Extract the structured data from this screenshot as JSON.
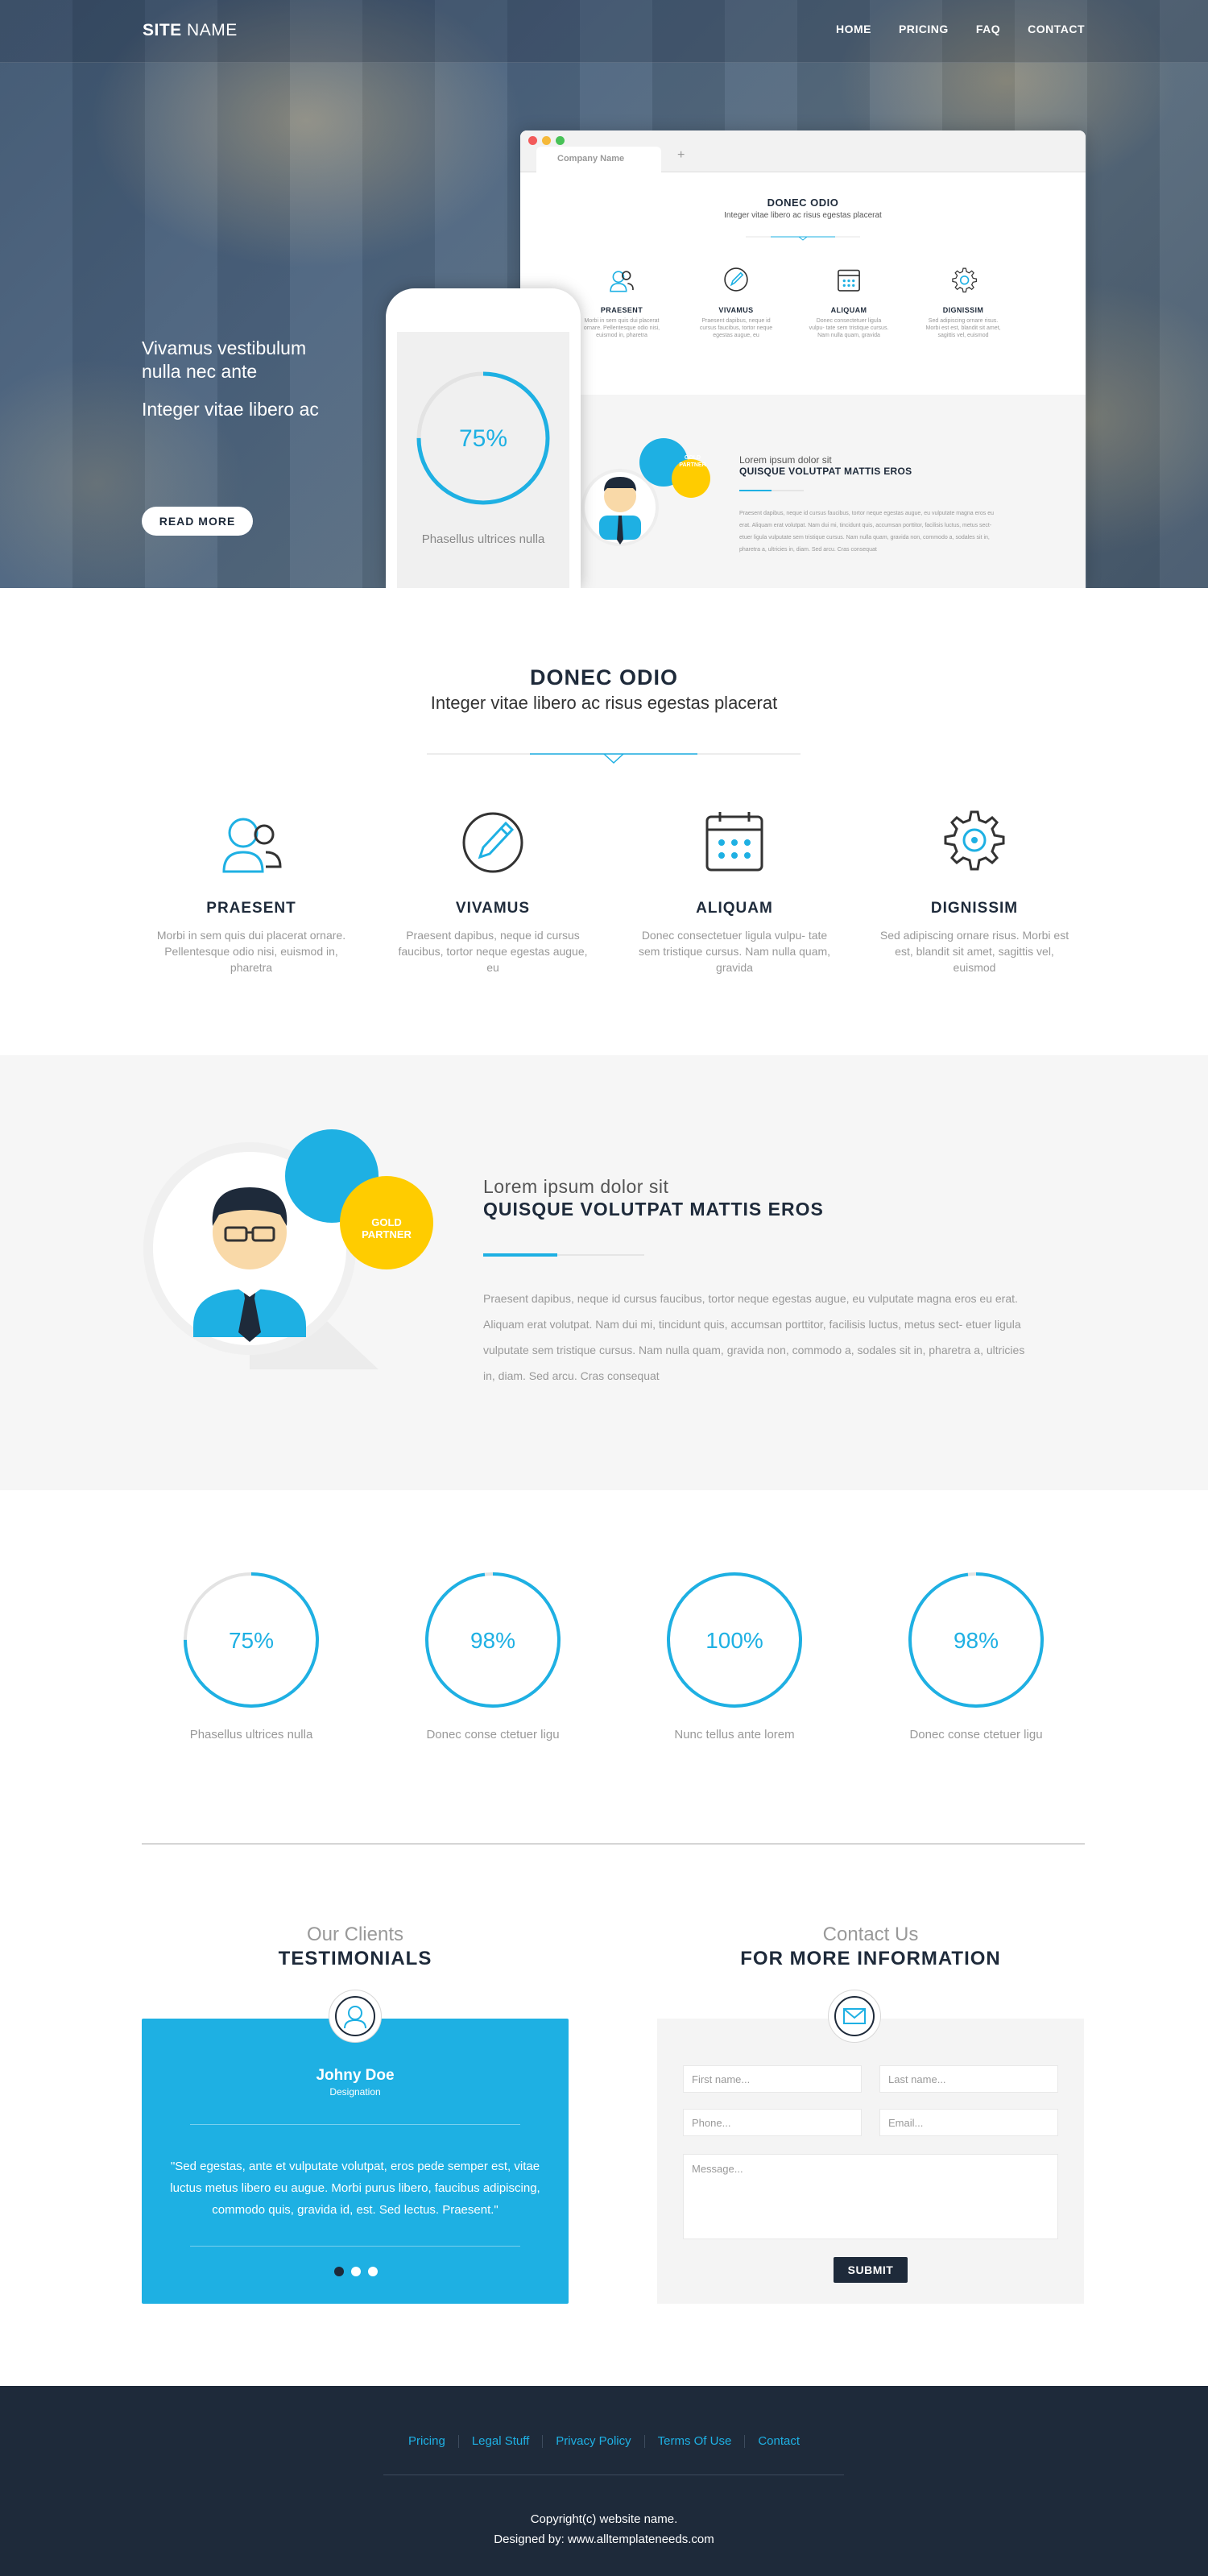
{
  "site": {
    "name_bold": "SITE",
    "name_rest": " NAME"
  },
  "nav": [
    "HOME",
    "PRICING",
    "FAQ",
    "CONTACT"
  ],
  "hero": {
    "line1": "Vivamus vestibulum nulla nec ante",
    "line2": "Integer vitae libero ac",
    "cta": "READ MORE",
    "browser_tab": "Company Name",
    "browser_plus": "+",
    "phone_percent": "75%",
    "phone_label": "Phasellus ultrices nulla",
    "mini_partner_lead": "Lorem ipsum dolor sit",
    "mini_partner_title": "QUISQUE VOLUTPAT MATTIS EROS",
    "mini_badge": "GOLD PARTNER"
  },
  "intro": {
    "title": "DONEC ODIO",
    "subtitle": "Integer vitae libero ac risus egestas placerat"
  },
  "features": [
    {
      "icon": "user-group-icon",
      "title": "PRAESENT",
      "text": "Morbi in sem quis dui placerat ornare. Pellentesque odio nisi, euismod in, pharetra"
    },
    {
      "icon": "pencil-circle-icon",
      "title": "VIVAMUS",
      "text": "Praesent dapibus, neque id cursus faucibus, tortor neque egestas augue, eu"
    },
    {
      "icon": "calendar-icon",
      "title": "ALIQUAM",
      "text": "Donec consectetuer ligula vulpu- tate sem tristique cursus. Nam nulla quam, gravida"
    },
    {
      "icon": "gear-icon",
      "title": "DIGNISSIM",
      "text": "Sed adipiscing ornare risus. Morbi est est, blandit sit amet, sagittis vel, euismod"
    }
  ],
  "partner": {
    "badge": "GOLD PARTNER",
    "lead": "Lorem ipsum dolor sit",
    "title": "QUISQUE VOLUTPAT MATTIS EROS",
    "text": "Praesent dapibus, neque id cursus faucibus, tortor neque egestas augue, eu vulputate magna eros eu erat. Aliquam erat volutpat. Nam dui mi, tincidunt quis, accumsan porttitor, facilisis luctus, metus sect- etuer ligula vulputate sem tristique cursus. Nam nulla quam, gravida non, commodo a, sodales sit  in, pharetra a, ultricies in, diam. Sed arcu. Cras consequat"
  },
  "stats": [
    {
      "value": 75,
      "display": "75%",
      "label": "Phasellus ultrices nulla"
    },
    {
      "value": 98,
      "display": "98%",
      "label": "Donec conse ctetuer ligu"
    },
    {
      "value": 100,
      "display": "100%",
      "label": "Nunc tellus ante lorem"
    },
    {
      "value": 98,
      "display": "98%",
      "label": "Donec conse ctetuer ligu"
    }
  ],
  "testimonials": {
    "lead": "Our Clients",
    "title": "TESTIMONIALS",
    "name": "Johny Doe",
    "designation": "Designation",
    "quote": "\"Sed egestas, ante et vulputate volutpat, eros pede semper est, vitae luctus metus libero eu augue. Morbi purus libero, faucibus adipiscing, commodo quis, gravida id, est. Sed lectus. Praesent.\""
  },
  "contact": {
    "lead": "Contact Us",
    "title": "FOR MORE INFORMATION",
    "first_name": "First name...",
    "last_name": "Last name...",
    "phone": "Phone...",
    "email": "Email...",
    "message": "Message...",
    "submit": "SUBMIT"
  },
  "footer": {
    "links": [
      "Pricing",
      "Legal Stuff",
      "Privacy Policy",
      "Terms Of Use",
      "Contact"
    ],
    "copyright": "Copyright(c) website name.",
    "designed_by": "Designed by: www.alltemplateneeds.com"
  },
  "colors": {
    "accent": "#1eb0e3",
    "dark": "#1e2a3a",
    "gold": "#ffcc00"
  }
}
